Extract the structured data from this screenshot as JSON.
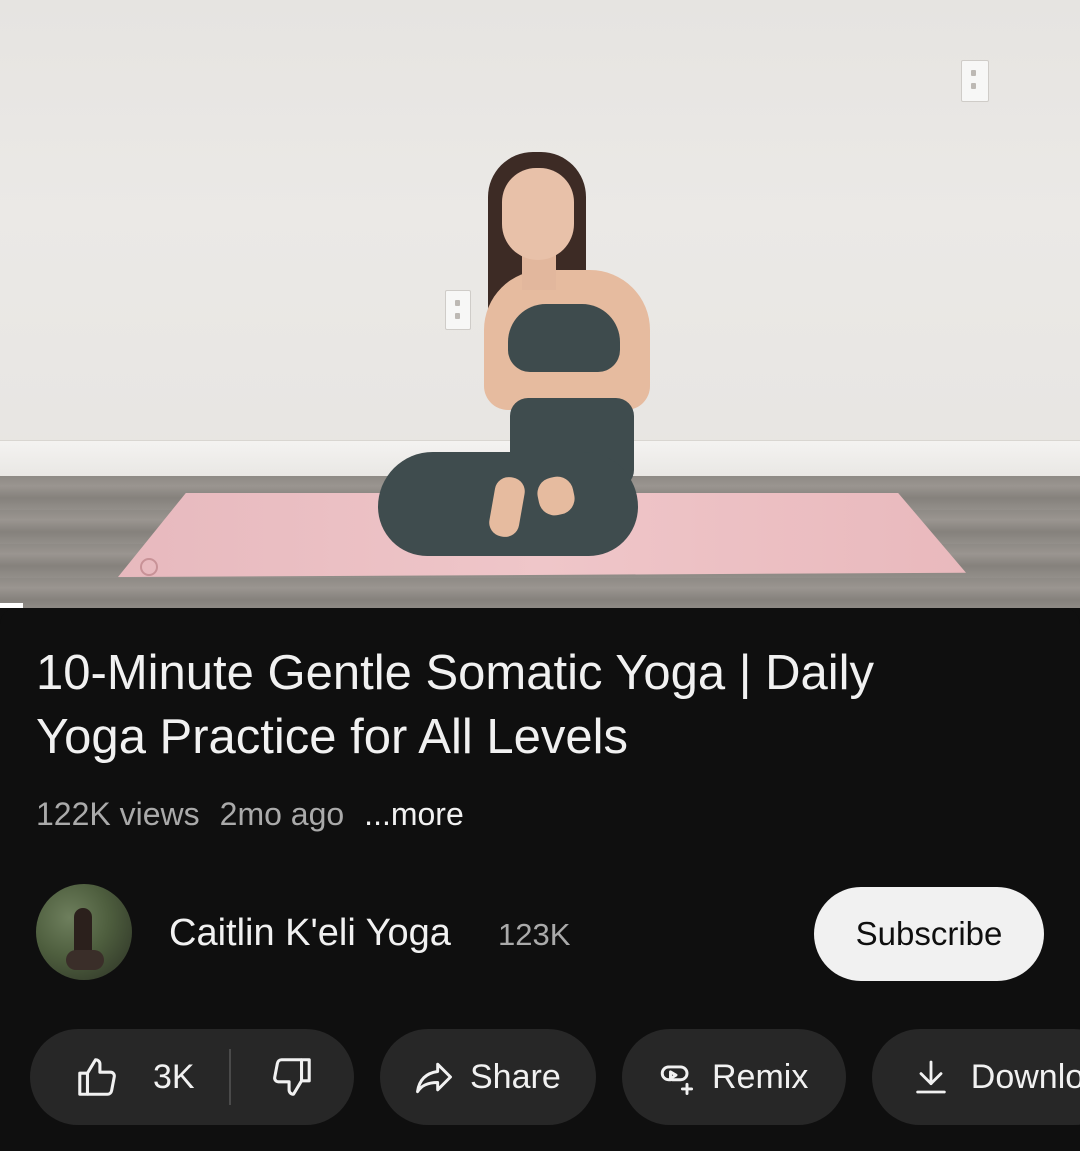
{
  "video": {
    "progress_fraction": 0.021
  },
  "title": {
    "line1": "10-Minute Gentle Somatic Yoga | Daily",
    "line2": "Yoga Practice for All Levels"
  },
  "meta": {
    "views": "122K views",
    "age": "2mo ago",
    "more": "...more"
  },
  "channel": {
    "name": "Caitlin K'eli Yoga",
    "subscribers": "123K",
    "subscribe_label": "Subscribe"
  },
  "actions": {
    "like_count": "3K",
    "share_label": "Share",
    "remix_label": "Remix",
    "download_label": "Download"
  },
  "icons": {
    "like": "thumbs-up-icon",
    "dislike": "thumbs-down-icon",
    "share": "share-arrow-icon",
    "remix": "remix-icon",
    "download": "download-icon"
  },
  "colors": {
    "background": "#0f0f0f",
    "pill": "#272727",
    "subscribe_bg": "#f1f1f1",
    "text_primary": "#f1f1f1",
    "text_secondary": "#aaaaaa"
  }
}
